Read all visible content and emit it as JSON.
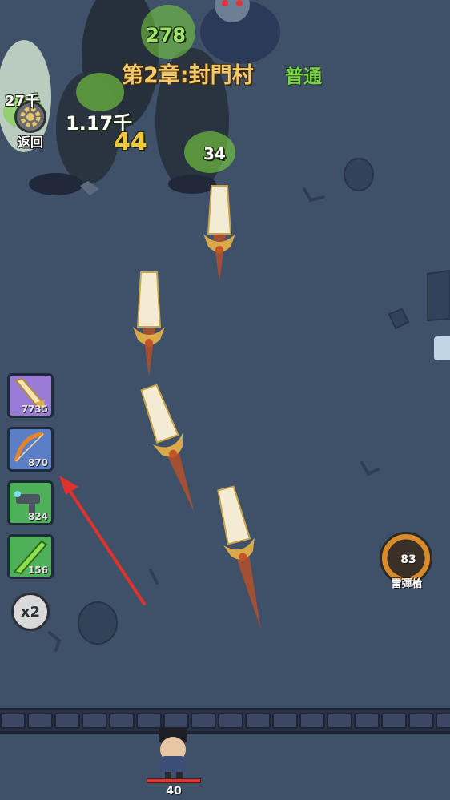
{
  "header": {
    "chapter_title": "第2章:封門村",
    "difficulty": "普通"
  },
  "back_button": {
    "label": "返回",
    "icon": "gear-icon"
  },
  "damage_numbers": [
    "278",
    "1.17千",
    "44",
    "34",
    "27千"
  ],
  "weapons": [
    {
      "name": "golden-sword",
      "count": "7735",
      "bg": "#9a7bd6"
    },
    {
      "name": "flame-bow",
      "count": "870",
      "bg": "#5b7fc6"
    },
    {
      "name": "thunder-gun",
      "count": "824",
      "bg": "#4fb05a"
    },
    {
      "name": "jade-blade",
      "count": "156",
      "bg": "#4fb05a"
    }
  ],
  "speed_toggle": {
    "label": "x2"
  },
  "skill": {
    "count": "83",
    "label": "雷彈槍"
  },
  "player": {
    "hp": "40"
  },
  "colors": {
    "background": "#3f5168",
    "chapter_gold": "#f3c96a",
    "difficulty_green": "#7bd34a",
    "hp_red": "#d73a35"
  }
}
